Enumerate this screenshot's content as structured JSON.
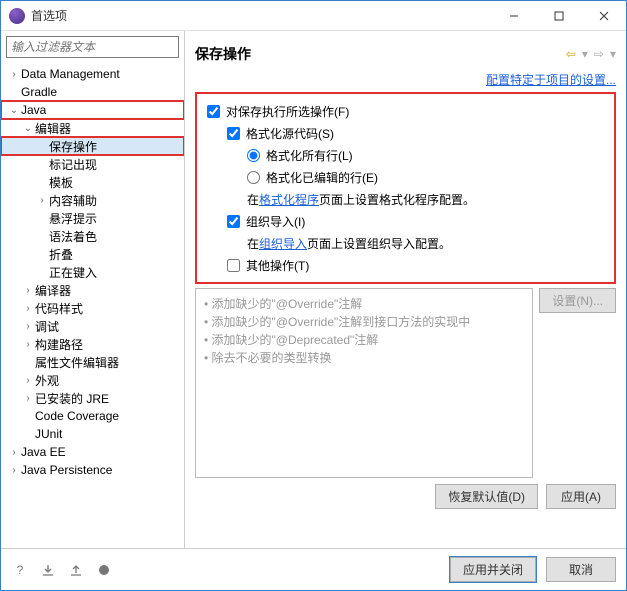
{
  "window": {
    "title": "首选项"
  },
  "filter": {
    "placeholder": "输入过滤器文本"
  },
  "tree": {
    "data_mgmt": "Data Management",
    "gradle": "Gradle",
    "java": "Java",
    "editor": "编辑器",
    "save_actions": "保存操作",
    "mark_occur": "标记出现",
    "templates": "模板",
    "content_assist": "内容辅助",
    "hovers": "悬浮提示",
    "syntax_color": "语法着色",
    "folding": "折叠",
    "typing": "正在键入",
    "compiler": "编译器",
    "code_style": "代码样式",
    "debug": "调试",
    "build_path": "构建路径",
    "prop_file_editor": "属性文件编辑器",
    "appearance": "外观",
    "installed_jre": "已安装的 JRE",
    "code_coverage": "Code Coverage",
    "junit": "JUnit",
    "java_ee": "Java EE",
    "java_persist": "Java Persistence"
  },
  "page": {
    "title": "保存操作",
    "project_link": "配置特定于项目的设置...",
    "opt_perform": "对保存执行所选操作(F)",
    "opt_format": "格式化源代码(S)",
    "opt_format_all": "格式化所有行(L)",
    "opt_format_edited": "格式化已编辑的行(E)",
    "opt_format_link_pre": "在",
    "opt_format_link": "格式化程序",
    "opt_format_link_post": "页面上设置格式化程序配置。",
    "opt_organize": "组织导入(I)",
    "opt_organize_link_pre": "在",
    "opt_organize_link": "组织导入",
    "opt_organize_link_post": "页面上设置组织导入配置。",
    "opt_other": "其他操作(T)",
    "setting_btn": "设置(N)...",
    "list": {
      "i1": "添加缺少的\"@Override\"注解",
      "i2": "添加缺少的\"@Override\"注解到接口方法的实现中",
      "i3": "添加缺少的\"@Deprecated\"注解",
      "i4": "除去不必要的类型转换"
    },
    "restore": "恢复默认值(D)",
    "apply": "应用(A)"
  },
  "footer": {
    "apply_close": "应用并关闭",
    "cancel": "取消"
  }
}
